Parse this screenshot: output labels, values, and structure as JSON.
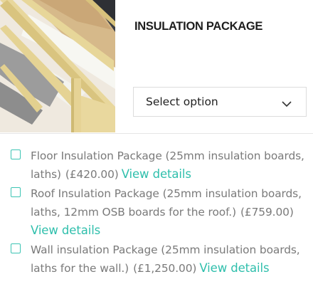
{
  "product": {
    "title": "INSULATION PACKAGE",
    "image_alt": "roof-insulation-image"
  },
  "select": {
    "value": "Select option",
    "icon": "chevron-down-icon"
  },
  "options": [
    {
      "name": "Floor Insulation Package (25mm insulation boards,",
      "name_cont": "laths)",
      "price": "(£420.00)",
      "link": "View details",
      "checked": false
    },
    {
      "name": "Roof Insulation Package (25mm insulation boards,",
      "name_cont": "laths, 12mm OSB boards for the roof.)",
      "price": "(£759.00)",
      "link": "View details",
      "checked": false
    },
    {
      "name": "Wall insulation Package (25mm insulation boards,",
      "name_cont": "laths for the wall.)",
      "price": "(£1,250.00)",
      "link": "View details",
      "checked": false
    }
  ],
  "colors": {
    "accent": "#2fbfac",
    "text": "#7a7a7a",
    "title": "#1e1e1e"
  }
}
